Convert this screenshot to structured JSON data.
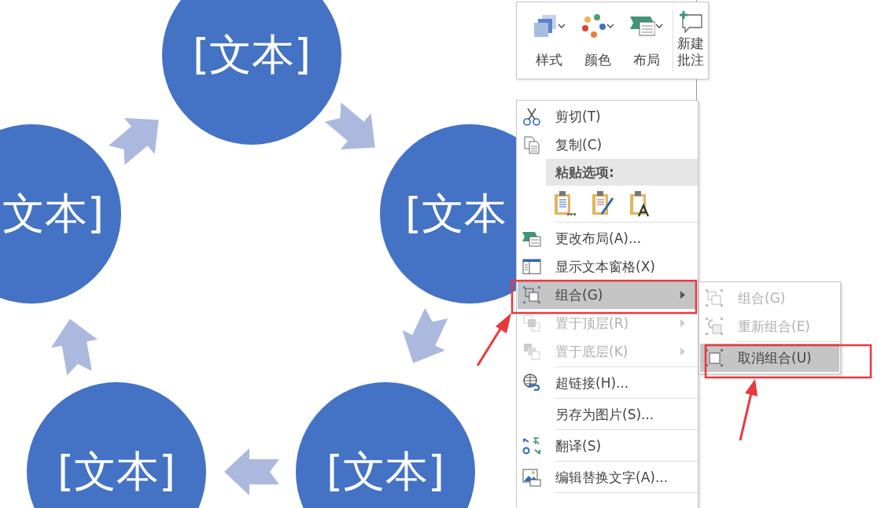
{
  "diagram": {
    "nodes": [
      {
        "text": "[文本]"
      },
      {
        "text": "[文本"
      },
      {
        "text": "[文本]"
      },
      {
        "text": "[文本]"
      },
      {
        "text": "文本]"
      }
    ]
  },
  "mini_toolbar": {
    "buttons": [
      {
        "label": "样式",
        "kind": "dropdown"
      },
      {
        "label": "颜色",
        "kind": "dropdown"
      },
      {
        "label": "布局",
        "kind": "dropdown"
      },
      {
        "label": "新建批注",
        "kind": "button"
      }
    ]
  },
  "context_menu": {
    "items": [
      {
        "kind": "item",
        "label": "剪切(T)",
        "disabled": false,
        "selected": false,
        "submenu": false
      },
      {
        "kind": "item",
        "label": "复制(C)",
        "disabled": false,
        "selected": false,
        "submenu": false
      },
      {
        "kind": "header",
        "label": "粘贴选项:"
      },
      {
        "kind": "paste_options"
      },
      {
        "kind": "separator"
      },
      {
        "kind": "item",
        "label": "更改布局(A)...",
        "disabled": false,
        "selected": false,
        "submenu": false
      },
      {
        "kind": "item",
        "label": "显示文本窗格(X)",
        "disabled": false,
        "selected": false,
        "submenu": false
      },
      {
        "kind": "item",
        "label": "组合(G)",
        "disabled": false,
        "selected": true,
        "submenu": true
      },
      {
        "kind": "item",
        "label": "置于顶层(R)",
        "disabled": true,
        "selected": false,
        "submenu": true
      },
      {
        "kind": "item",
        "label": "置于底层(K)",
        "disabled": true,
        "selected": false,
        "submenu": true
      },
      {
        "kind": "separator"
      },
      {
        "kind": "item",
        "label": "超链接(H)...",
        "disabled": false,
        "selected": false,
        "submenu": false
      },
      {
        "kind": "separator"
      },
      {
        "kind": "item",
        "label": "另存为图片(S)...",
        "disabled": false,
        "selected": false,
        "submenu": false
      },
      {
        "kind": "separator"
      },
      {
        "kind": "item",
        "label": "翻译(S)",
        "disabled": false,
        "selected": false,
        "submenu": false
      },
      {
        "kind": "separator"
      },
      {
        "kind": "item",
        "label": "编辑替换文字(A)...",
        "disabled": false,
        "selected": false,
        "submenu": false
      },
      {
        "kind": "separator"
      }
    ]
  },
  "submenu": {
    "items": [
      {
        "kind": "item",
        "label": "组合(G)",
        "disabled": true,
        "selected": false
      },
      {
        "kind": "item",
        "label": "重新组合(E)",
        "disabled": true,
        "selected": false
      },
      {
        "kind": "separator"
      },
      {
        "kind": "item",
        "label": "取消组合(U)",
        "disabled": false,
        "selected": true
      }
    ]
  }
}
